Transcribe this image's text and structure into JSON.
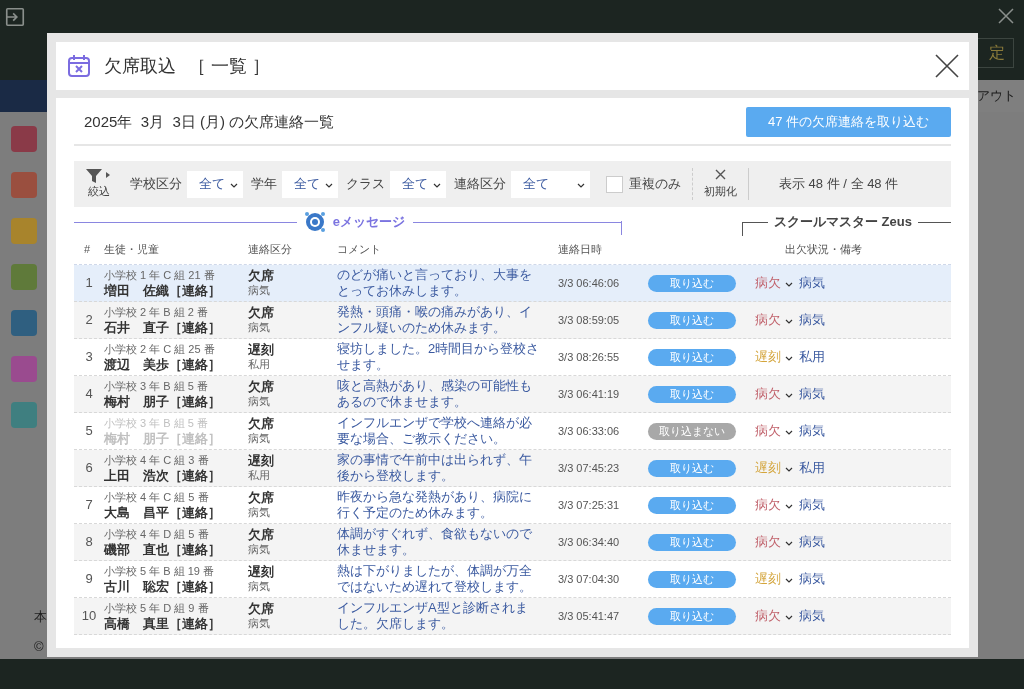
{
  "background": {
    "top_button": "定",
    "top_link": "アウト",
    "footer": [
      "本",
      "©"
    ]
  },
  "modal": {
    "title": "欠席取込",
    "subtitle": "［ 一覧 ］",
    "heading": "2025年  3月  3日 (月) の欠席連絡一覧",
    "import_button": "47 件の欠席連絡を取り込む"
  },
  "filters": {
    "label": "絞込",
    "selects": [
      {
        "label": "学校区分",
        "value": "全て"
      },
      {
        "label": "学年",
        "value": "全て"
      },
      {
        "label": "クラス",
        "value": "全て"
      },
      {
        "label": "連絡区分",
        "value": "全て"
      }
    ],
    "duplicate": {
      "label": "重複のみ",
      "checked": false
    },
    "reset": "初期化",
    "count": "表示 48 件 / 全 48 件"
  },
  "sources": {
    "emessage": "eメッセージ",
    "zeus": "スクールマスター Zeus"
  },
  "columns": [
    "#",
    "生徒・児童",
    "連絡区分",
    "コメント",
    "連絡日時",
    "出欠状況・備考"
  ],
  "rows": [
    {
      "no": "1",
      "class": "小学校 1 年 C 組 21 番",
      "name": "増田　佐織",
      "tag": "［連絡］",
      "type": "欠席",
      "reason": "病気",
      "comment": "のどが痛いと言っており、大事をとってお休みします。",
      "time": "3/3 06:46:06",
      "action": "取り込む",
      "enabled": true,
      "selected": true,
      "status": {
        "label": "病欠",
        "color": "#c0606a"
      },
      "note": "病気"
    },
    {
      "no": "2",
      "class": "小学校 2 年 B 組 2 番",
      "name": "石井　直子",
      "tag": "［連絡］",
      "type": "欠席",
      "reason": "病気",
      "comment": "発熱・頭痛・喉の痛みがあり、インフル疑いのため休みます。",
      "time": "3/3 08:59:05",
      "action": "取り込む",
      "enabled": true,
      "selected": false,
      "status": {
        "label": "病欠",
        "color": "#c0606a"
      },
      "note": "病気"
    },
    {
      "no": "3",
      "class": "小学校 2 年 C 組 25 番",
      "name": "渡辺　美歩",
      "tag": "［連絡］",
      "type": "遅刻",
      "reason": "私用",
      "comment": "寝坊しました。2時間目から登校させます。",
      "time": "3/3 08:26:55",
      "action": "取り込む",
      "enabled": true,
      "selected": false,
      "status": {
        "label": "遅刻",
        "color": "#d4a53c"
      },
      "note": "私用"
    },
    {
      "no": "4",
      "class": "小学校 3 年 B 組 5 番",
      "name": "梅村　朋子",
      "tag": "［連絡］",
      "type": "欠席",
      "reason": "病気",
      "comment": "咳と高熱があり、感染の可能性もあるので休ませます。",
      "time": "3/3 06:41:19",
      "action": "取り込む",
      "enabled": true,
      "selected": false,
      "status": {
        "label": "病欠",
        "color": "#c0606a"
      },
      "note": "病気"
    },
    {
      "no": "5",
      "class": "小学校 3 年 B 組 5 番",
      "name": "梅村　朋子",
      "tag": "［連絡］",
      "type": "欠席",
      "reason": "病気",
      "comment": "インフルエンザで学校へ連絡が必要な場合、ご教示ください。",
      "time": "3/3 06:33:06",
      "action": "取り込まない",
      "enabled": false,
      "selected": false,
      "status": {
        "label": "病欠",
        "color": "#c0606a"
      },
      "note": "病気"
    },
    {
      "no": "6",
      "class": "小学校 4 年 C 組 3 番",
      "name": "上田　浩次",
      "tag": "［連絡］",
      "type": "遅刻",
      "reason": "私用",
      "comment": "家の事情で午前中は出られず、午後から登校します。",
      "time": "3/3 07:45:23",
      "action": "取り込む",
      "enabled": true,
      "selected": false,
      "status": {
        "label": "遅刻",
        "color": "#d4a53c"
      },
      "note": "私用"
    },
    {
      "no": "7",
      "class": "小学校 4 年 C 組 5 番",
      "name": "大島　昌平",
      "tag": "［連絡］",
      "type": "欠席",
      "reason": "病気",
      "comment": "昨夜から急な発熱があり、病院に行く予定のため休みます。",
      "time": "3/3 07:25:31",
      "action": "取り込む",
      "enabled": true,
      "selected": false,
      "status": {
        "label": "病欠",
        "color": "#c0606a"
      },
      "note": "病気"
    },
    {
      "no": "8",
      "class": "小学校 4 年 D 組 5 番",
      "name": "磯部　直也",
      "tag": "［連絡］",
      "type": "欠席",
      "reason": "病気",
      "comment": "体調がすぐれず、食欲もないので休ませます。",
      "time": "3/3 06:34:40",
      "action": "取り込む",
      "enabled": true,
      "selected": false,
      "status": {
        "label": "病欠",
        "color": "#c0606a"
      },
      "note": "病気"
    },
    {
      "no": "9",
      "class": "小学校 5 年 B 組 19 番",
      "name": "古川　聡宏",
      "tag": "［連絡］",
      "type": "遅刻",
      "reason": "病気",
      "comment": "熱は下がりましたが、体調が万全ではないため遅れて登校します。",
      "time": "3/3 07:04:30",
      "action": "取り込む",
      "enabled": true,
      "selected": false,
      "status": {
        "label": "遅刻",
        "color": "#d4a53c"
      },
      "note": "病気"
    },
    {
      "no": "10",
      "class": "小学校 5 年 D 組 9 番",
      "name": "高橋　真里",
      "tag": "［連絡］",
      "type": "欠席",
      "reason": "病気",
      "comment": "インフルエンザA型と診断されました。欠席します。",
      "time": "3/3 05:41:47",
      "action": "取り込む",
      "enabled": true,
      "selected": false,
      "status": {
        "label": "病欠",
        "color": "#c0606a"
      },
      "note": "病気"
    }
  ]
}
